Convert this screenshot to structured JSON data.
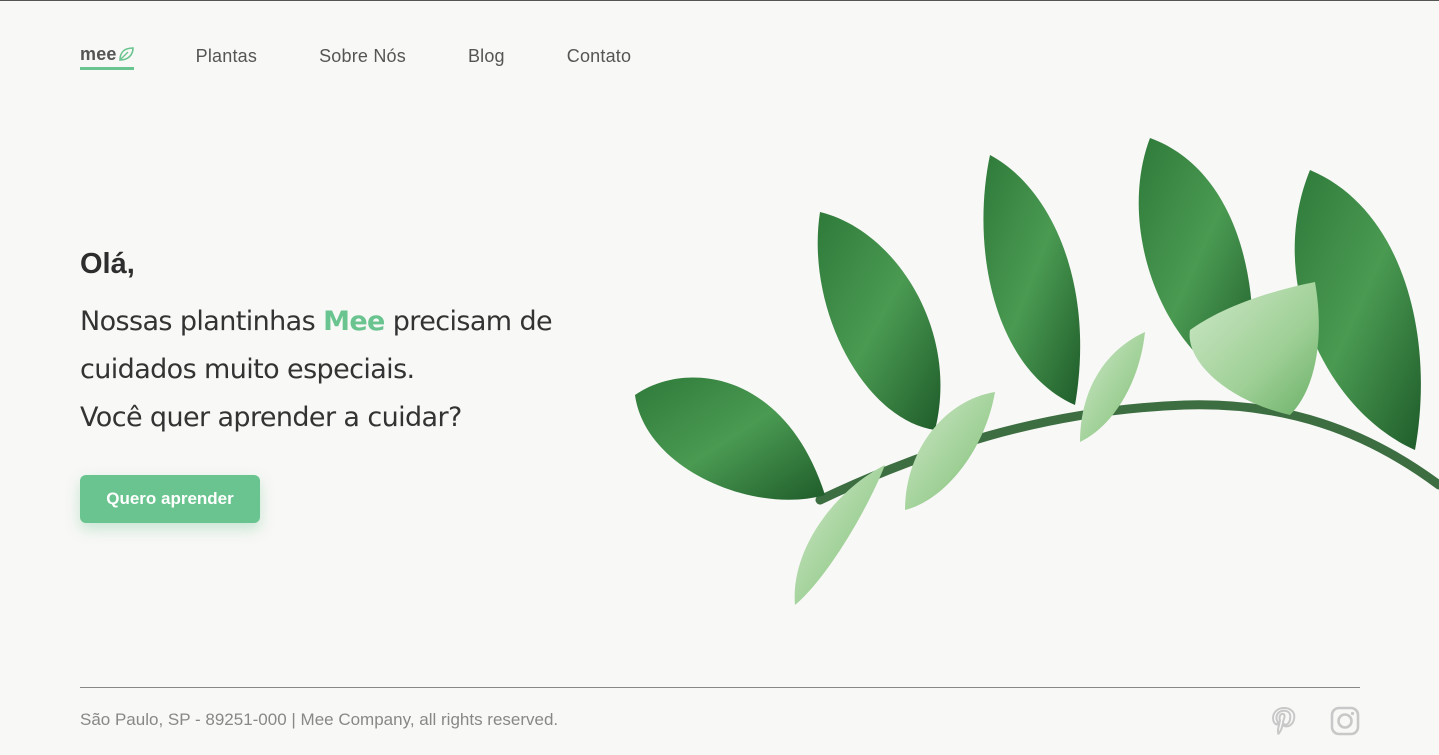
{
  "brand": {
    "name": "mee",
    "accent": "#6ac48f"
  },
  "nav": {
    "items": [
      {
        "label": "Plantas"
      },
      {
        "label": "Sobre Nós"
      },
      {
        "label": "Blog"
      },
      {
        "label": "Contato"
      }
    ]
  },
  "hero": {
    "greeting": "Olá,",
    "line1_before": "Nossas plantinhas ",
    "line1_highlight": "Mee",
    "line1_after": " precisam de",
    "line2": "cuidados muito especiais.",
    "line3": "Você quer aprender a cuidar?",
    "cta_label": "Quero aprender"
  },
  "footer": {
    "text": "São Paulo, SP - 89251-000 | Mee Company, all rights reserved.",
    "social": [
      "pinterest-icon",
      "instagram-icon"
    ]
  }
}
